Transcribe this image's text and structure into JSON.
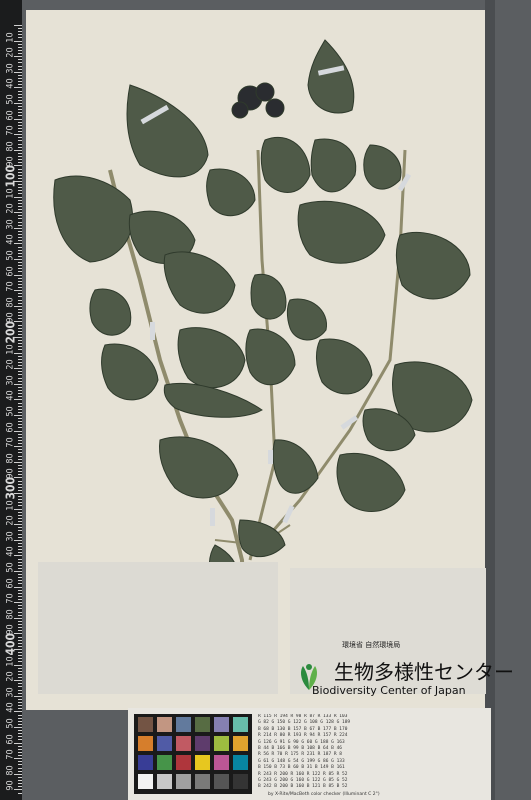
{
  "ruler": {
    "major_labels": [
      "10",
      "20",
      "30",
      "40",
      "50",
      "60",
      "70",
      "80",
      "90",
      "100",
      "10",
      "20",
      "30",
      "40",
      "50",
      "60",
      "70",
      "80",
      "90",
      "200",
      "10",
      "20",
      "30",
      "40",
      "50",
      "60",
      "70",
      "80",
      "90",
      "300",
      "10",
      "20",
      "30",
      "40",
      "50",
      "60",
      "70",
      "80",
      "90",
      "400",
      "10",
      "20",
      "30",
      "40",
      "50",
      "60",
      "70",
      "80",
      "90",
      "500"
    ]
  },
  "institution": {
    "ministry_jp": "環境省 自然環境局",
    "center_jp": "生物多様性センター",
    "center_en": "Biodiversity Center of Japan"
  },
  "color_card": {
    "caption": "by X-Rite/MacBeth color checker (Illuminant C 2°)",
    "rows": [
      "R 115  R 194  R 98   R 87   R 133  R 103",
      "G 82   G 150  G 122  G 108  G 128  G 189",
      "B 68   B 130  B 157  B 67   B 177  B 170",
      "R 214  R 80   R 193  R 94   R 157  R 224",
      "G 126  G 91   G 90   G 60   G 188  G 163",
      "B 44   B 166  B 99   B 108  B 64   B 46",
      "R 56   R 70   R 175  R 231  R 187  R 8",
      "G 61   G 148  G 54   G 199  G 86   G 133",
      "B 150  B 73   B 60   B 31   B 149  B 161",
      "R 243  R 200  R 160  R 122  R 85   R 52",
      "G 243  G 200  G 160  G 122  G 85   G 52",
      "B 242  B 200  B 160  B 121  B 85   B 52"
    ],
    "swatches": [
      "#735444",
      "#c29682",
      "#627a9d",
      "#576c43",
      "#8580b1",
      "#67bdaa",
      "#d67e2c",
      "#505ba6",
      "#c15a63",
      "#5e3c6c",
      "#9dbc40",
      "#e0a32e",
      "#383d96",
      "#469449",
      "#af363c",
      "#e7c71f",
      "#bb5695",
      "#0885a1",
      "#f3f3f2",
      "#c8c8c8",
      "#a0a0a0",
      "#7a7a79",
      "#555555",
      "#343434"
    ]
  }
}
